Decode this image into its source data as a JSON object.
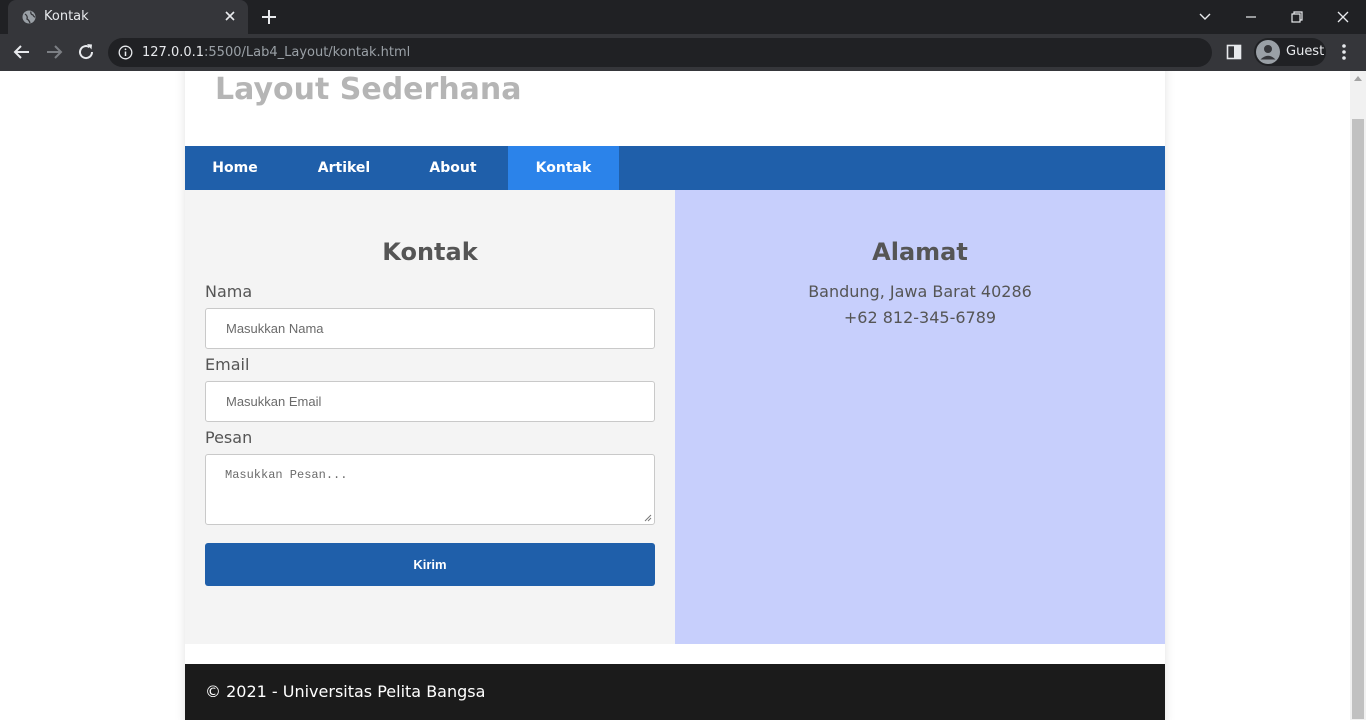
{
  "browser": {
    "tab_title": "Kontak",
    "url_host": "127.0.0.1",
    "url_rest": ":5500/Lab4_Layout/kontak.html",
    "profile_label": "Guest"
  },
  "site": {
    "title": "Layout Sederhana",
    "nav": [
      {
        "label": "Home"
      },
      {
        "label": "Artikel"
      },
      {
        "label": "About"
      },
      {
        "label": "Kontak",
        "active": true
      }
    ]
  },
  "contact": {
    "heading": "Kontak",
    "name_label": "Nama",
    "name_placeholder": "Masukkan Nama",
    "email_label": "Email",
    "email_placeholder": "Masukkan Email",
    "message_label": "Pesan",
    "message_placeholder": "Masukkan Pesan...",
    "submit_label": "Kirim"
  },
  "address": {
    "heading": "Alamat",
    "line1": "Bandung, Jawa Barat 40286",
    "line2": "+62 812-345-6789"
  },
  "footer": {
    "text": "© 2021 - Universitas Pelita Bangsa"
  },
  "colors": {
    "nav_bg": "#1f5faa",
    "nav_active": "#2b83ea",
    "address_bg": "#c7cffc",
    "form_bg": "#f4f4f4",
    "footer_bg": "#1b1b1b"
  }
}
